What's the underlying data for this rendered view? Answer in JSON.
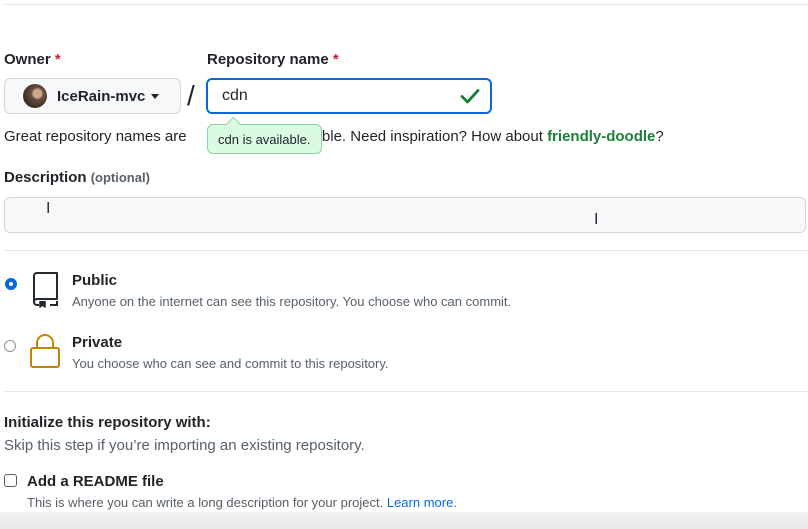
{
  "owner": {
    "label": "Owner",
    "required_mark": "*",
    "selected": "IceRain-mvc"
  },
  "repository": {
    "label": "Repository name",
    "required_mark": "*",
    "value": "cdn",
    "availability_tooltip": "cdn is available.",
    "hint_start": "Great repository names are",
    "hint_mid": "rable. Need inspiration? How about",
    "suggestion": "friendly-doodle",
    "hint_end": "?"
  },
  "description": {
    "label": "Description",
    "optional": "(optional)",
    "value": ""
  },
  "visibility": {
    "options": [
      {
        "title": "Public",
        "desc": "Anyone on the internet can see this repository. You choose who can commit.",
        "selected": true
      },
      {
        "title": "Private",
        "desc": "You choose who can see and commit to this repository.",
        "selected": false
      }
    ]
  },
  "initialize": {
    "title": "Initialize this repository with:",
    "subtitle": "Skip this step if you’re importing an existing repository.",
    "readme_label": "Add a README file",
    "readme_desc": "This is where you can write a long description for your project.",
    "readme_link": "Learn more.",
    "readme_checked": false
  },
  "colors": {
    "focus": "#0969da",
    "success": "#1a7f37",
    "required": "#cf222e",
    "private_icon": "#bf8700"
  },
  "icons": [
    "check-icon",
    "repo-icon",
    "lock-icon",
    "caret-down-icon",
    "text-cursor-icon"
  ]
}
